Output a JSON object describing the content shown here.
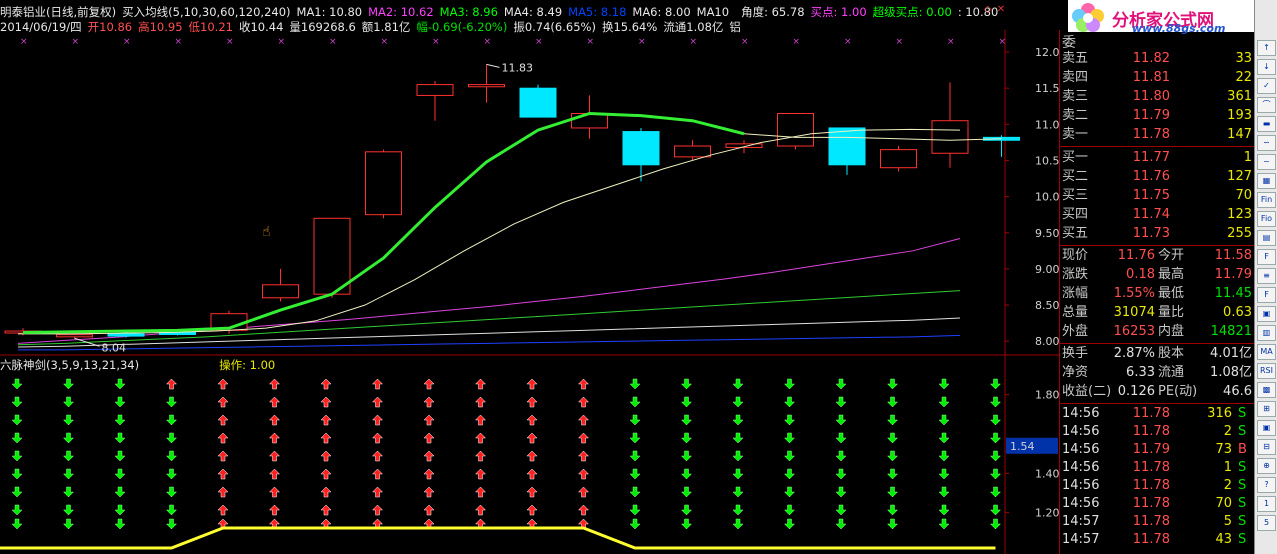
{
  "header": {
    "title": "明泰铝业(日线,前复权)",
    "indicator": "买入均线(5,10,30,60,120,240)",
    "ma": [
      {
        "label": "MA1: 10.80",
        "color": "#e8e8e8"
      },
      {
        "label": "MA2: 10.62",
        "color": "#ff40ff"
      },
      {
        "label": "MA3: 8.96",
        "color": "#00ff00"
      },
      {
        "label": "MA4: 8.49",
        "color": "#e8e8e8"
      },
      {
        "label": "MA5: 8.18",
        "color": "#0044ff"
      },
      {
        "label": "MA6: 8.00",
        "color": "#e8e8e8"
      },
      {
        "label": "MA10",
        "color": "#e8e8e8"
      }
    ],
    "angle": "角度: 65.78",
    "buy": "买点: 1.00",
    "super_buy": "超级买点: 0.00",
    "extra": ": 10.80"
  },
  "info_line": {
    "date": "2014/06/19/四",
    "open": "开10.86",
    "high": "高10.95",
    "low": "低10.21",
    "close": "收10.44",
    "volume": "量169268.6",
    "amount": "额1.81亿",
    "change": "幅-0.69(-6.20%)",
    "amplitude": "振0.74(6.65%)",
    "turnover": "换15.64%",
    "float": "流通1.08亿",
    "sector": "铝"
  },
  "sub_header": {
    "name": "六脉神剑(3,5,9,13,21,34)",
    "op": "操作: 1.00"
  },
  "price_axis": [
    "12.00",
    "11.50",
    "11.00",
    "10.50",
    "10.00",
    "9.50",
    "9.00",
    "8.50",
    "8.00"
  ],
  "sub_axis": [
    "1.80",
    "1.40",
    "1.20",
    "1.54"
  ],
  "annotations": {
    "high": "11.83",
    "low": "8.04"
  },
  "chart_data": {
    "type": "candlestick",
    "candles": [
      {
        "o": 8.12,
        "h": 8.18,
        "l": 8.08,
        "c": 8.14
      },
      {
        "o": 8.06,
        "h": 8.1,
        "l": 8.04,
        "c": 8.09
      },
      {
        "o": 8.1,
        "h": 8.14,
        "l": 8.05,
        "c": 8.07
      },
      {
        "o": 8.12,
        "h": 8.15,
        "l": 8.08,
        "c": 8.11
      },
      {
        "o": 8.15,
        "h": 8.42,
        "l": 8.1,
        "c": 8.38
      },
      {
        "o": 8.6,
        "h": 9.0,
        "l": 8.55,
        "c": 8.78
      },
      {
        "o": 8.65,
        "h": 9.7,
        "l": 8.6,
        "c": 9.7
      },
      {
        "o": 9.75,
        "h": 10.65,
        "l": 9.7,
        "c": 10.62
      },
      {
        "o": 11.4,
        "h": 11.6,
        "l": 11.05,
        "c": 11.55
      },
      {
        "o": 11.52,
        "h": 11.83,
        "l": 11.3,
        "c": 11.55
      },
      {
        "o": 11.5,
        "h": 11.55,
        "l": 11.1,
        "c": 11.1
      },
      {
        "o": 10.95,
        "h": 11.4,
        "l": 10.8,
        "c": 11.15
      },
      {
        "o": 10.9,
        "h": 10.95,
        "l": 10.21,
        "c": 10.44
      },
      {
        "o": 10.55,
        "h": 10.78,
        "l": 10.5,
        "c": 10.7
      },
      {
        "o": 10.68,
        "h": 10.78,
        "l": 10.6,
        "c": 10.73
      },
      {
        "o": 10.7,
        "h": 11.15,
        "l": 10.65,
        "c": 11.15
      },
      {
        "o": 10.95,
        "h": 10.95,
        "l": 10.3,
        "c": 10.44
      },
      {
        "o": 10.4,
        "h": 10.7,
        "l": 10.35,
        "c": 10.65
      },
      {
        "o": 10.6,
        "h": 11.58,
        "l": 10.4,
        "c": 11.05
      },
      {
        "o": 10.82,
        "h": 10.85,
        "l": 10.55,
        "c": 10.78
      }
    ],
    "ylim": [
      7.85,
      12.25
    ],
    "ma_fast": [
      8.12,
      8.13,
      8.14,
      8.15,
      8.18,
      8.43,
      8.65,
      9.15,
      9.85,
      10.48,
      10.92,
      11.15,
      11.12,
      11.05,
      10.87,
      10.82,
      10.82,
      10.8,
      10.78,
      10.8
    ],
    "ma_slow": [
      8.1,
      8.1,
      8.11,
      8.12,
      8.14,
      8.18,
      8.28,
      8.5,
      8.85,
      9.25,
      9.62,
      9.92,
      10.15,
      10.38,
      10.58,
      10.75,
      10.87,
      10.92,
      10.93,
      10.92
    ],
    "ma3": [
      7.97,
      8.01,
      8.05,
      8.1,
      8.15,
      8.2,
      8.25,
      8.3,
      8.36,
      8.42,
      8.48,
      8.55,
      8.62,
      8.7,
      8.78,
      8.86,
      8.95,
      9.05,
      9.15,
      9.25,
      9.42
    ],
    "ma4": [
      7.95,
      7.97,
      8.0,
      8.03,
      8.06,
      8.1,
      8.14,
      8.18,
      8.22,
      8.26,
      8.3,
      8.34,
      8.38,
      8.42,
      8.46,
      8.5,
      8.54,
      8.58,
      8.62,
      8.66,
      8.7
    ],
    "ma5": [
      7.92,
      7.93,
      7.95,
      7.97,
      7.99,
      8.01,
      8.03,
      8.05,
      8.07,
      8.09,
      8.11,
      8.13,
      8.15,
      8.17,
      8.19,
      8.21,
      8.23,
      8.25,
      8.27,
      8.29,
      8.32
    ],
    "ma6": [
      7.88,
      7.88,
      7.89,
      7.9,
      7.91,
      7.92,
      7.93,
      7.94,
      7.95,
      7.96,
      7.97,
      7.98,
      7.99,
      8.0,
      8.01,
      8.02,
      8.03,
      8.04,
      8.05,
      8.06,
      8.08
    ],
    "signal_line": [
      0,
      0,
      0,
      0,
      1,
      1,
      1,
      1,
      1,
      1,
      1,
      1,
      0,
      0,
      0,
      0,
      0,
      0,
      0,
      0
    ],
    "arrows_red_count": [
      0,
      0,
      0,
      1,
      6,
      6,
      6,
      6,
      6,
      6,
      6,
      6,
      0,
      0,
      0,
      0,
      0,
      0,
      0,
      0
    ],
    "arrows_rows": 6
  },
  "quote": {
    "sell": [
      {
        "label": "卖五",
        "price": "11.82",
        "vol": "33"
      },
      {
        "label": "卖四",
        "price": "11.81",
        "vol": "22"
      },
      {
        "label": "卖三",
        "price": "11.80",
        "vol": "361"
      },
      {
        "label": "卖二",
        "price": "11.79",
        "vol": "193"
      },
      {
        "label": "卖一",
        "price": "11.78",
        "vol": "147"
      }
    ],
    "buy": [
      {
        "label": "买一",
        "price": "11.77",
        "vol": "1"
      },
      {
        "label": "买二",
        "price": "11.76",
        "vol": "127"
      },
      {
        "label": "买三",
        "price": "11.75",
        "vol": "70"
      },
      {
        "label": "买四",
        "price": "11.74",
        "vol": "123"
      },
      {
        "label": "买五",
        "price": "11.73",
        "vol": "255"
      }
    ],
    "stats1": [
      {
        "l1": "现价",
        "v1": "11.76",
        "c1": "red",
        "l2": "今开",
        "v2": "11.58",
        "c2": "red"
      },
      {
        "l1": "涨跌",
        "v1": "0.18",
        "c1": "red",
        "l2": "最高",
        "v2": "11.79",
        "c2": "red"
      },
      {
        "l1": "涨幅",
        "v1": "1.55%",
        "c1": "red",
        "l2": "最低",
        "v2": "11.45",
        "c2": "green"
      },
      {
        "l1": "总量",
        "v1": "31074",
        "c1": "yellow",
        "l2": "量比",
        "v2": "0.63",
        "c2": "yellow"
      },
      {
        "l1": "外盘",
        "v1": "16253",
        "c1": "red",
        "l2": "内盘",
        "v2": "14821",
        "c2": "green"
      }
    ],
    "stats2": [
      {
        "l1": "换手",
        "v1": "2.87%",
        "l2": "股本",
        "v2": "4.01亿"
      },
      {
        "l1": "净资",
        "v1": "6.33",
        "l2": "流通",
        "v2": "1.08亿"
      },
      {
        "l1": "收益(二)",
        "v1": "0.126",
        "l2": "PE(动)",
        "v2": "46.6"
      }
    ],
    "ticks": [
      {
        "t": "14:56",
        "p": "11.78",
        "v": "316",
        "s": "S"
      },
      {
        "t": "14:56",
        "p": "11.78",
        "v": "2",
        "s": "S"
      },
      {
        "t": "14:56",
        "p": "11.79",
        "v": "73",
        "s": "B"
      },
      {
        "t": "14:56",
        "p": "11.78",
        "v": "1",
        "s": "S"
      },
      {
        "t": "14:56",
        "p": "11.78",
        "v": "2",
        "s": "S"
      },
      {
        "t": "14:56",
        "p": "11.78",
        "v": "70",
        "s": "S"
      },
      {
        "t": "14:57",
        "p": "11.78",
        "v": "5",
        "s": "S"
      },
      {
        "t": "14:57",
        "p": "11.78",
        "v": "43",
        "s": "S"
      }
    ],
    "wei": "委"
  },
  "logo": {
    "brand": "分析家公式网",
    "url": "www.88gs.com"
  },
  "toolbar": [
    "↑",
    "↓",
    "✓",
    "⌒",
    "▬",
    "∽",
    "~",
    "▦",
    "Fin",
    "Fio",
    "▤",
    "F",
    "≡",
    "F",
    "▣",
    "▥",
    "MA",
    "RSI",
    "▩",
    "⊞",
    "▣",
    "⊟",
    "⊕",
    "?",
    "1",
    "5"
  ],
  "colors": {
    "up": "#ff3030",
    "down": "#00e8ff",
    "ma_fast": "#33ee33",
    "frame": "#a00000"
  }
}
